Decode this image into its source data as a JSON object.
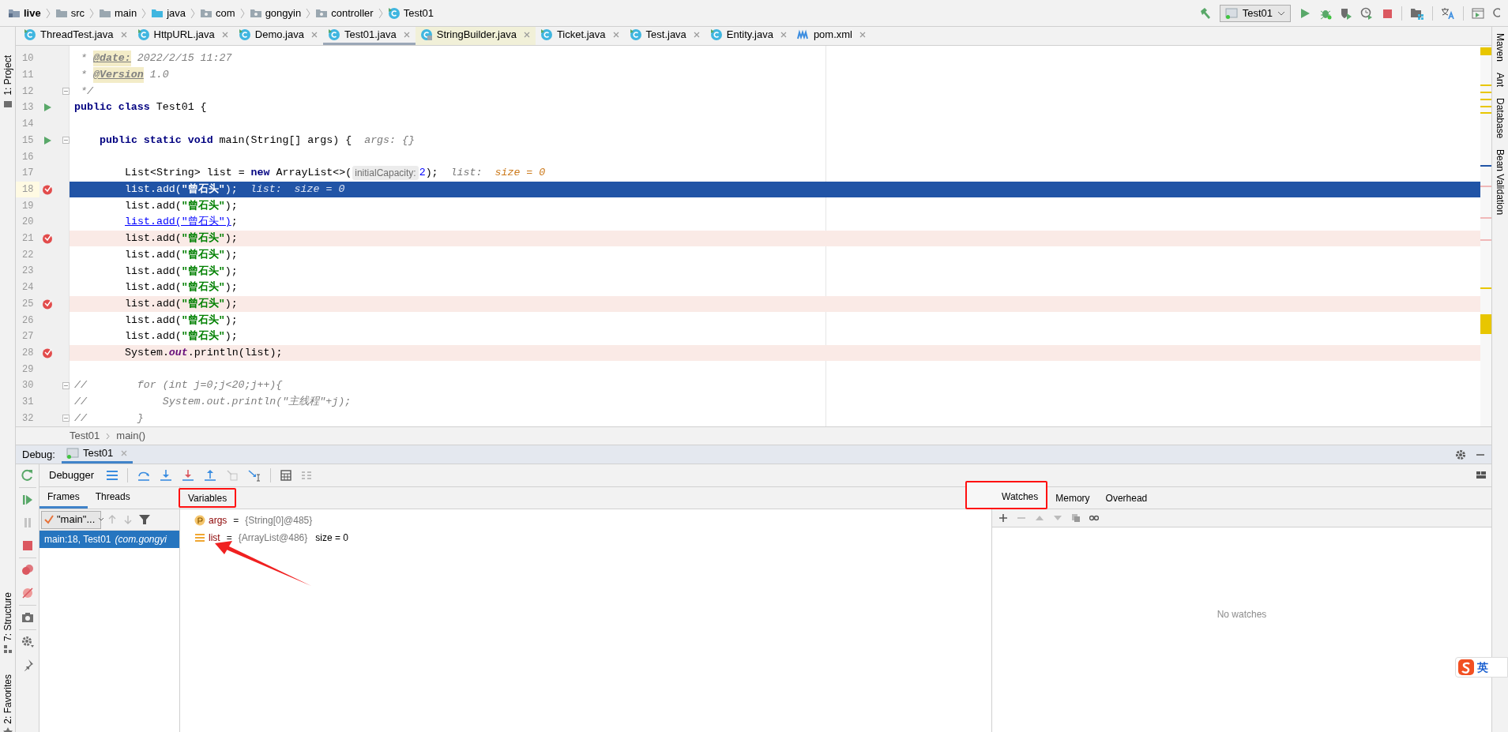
{
  "breadcrumbs": [
    {
      "label": "live",
      "kind": "module"
    },
    {
      "label": "src",
      "kind": "folder"
    },
    {
      "label": "main",
      "kind": "folder"
    },
    {
      "label": "java",
      "kind": "source-folder"
    },
    {
      "label": "com",
      "kind": "package"
    },
    {
      "label": "gongyin",
      "kind": "package"
    },
    {
      "label": "controller",
      "kind": "package"
    },
    {
      "label": "Test01",
      "kind": "class"
    }
  ],
  "run_config": {
    "label": "Test01"
  },
  "left_tool_windows": [
    {
      "label": "1: Project",
      "kind": "project"
    },
    {
      "label": "7: Structure",
      "kind": "structure"
    },
    {
      "label": "2: Favorites",
      "kind": "favorites"
    }
  ],
  "right_tool_windows": [
    {
      "label": "Maven"
    },
    {
      "label": "Ant"
    },
    {
      "label": "Database"
    },
    {
      "label": "Bean Validation"
    }
  ],
  "tabs": [
    {
      "label": "ThreadTest.java",
      "kind": "class",
      "selected": false
    },
    {
      "label": "HttpURL.java",
      "kind": "class",
      "selected": false
    },
    {
      "label": "Demo.java",
      "kind": "class",
      "selected": false
    },
    {
      "label": "Test01.java",
      "kind": "class",
      "selected": true
    },
    {
      "label": "StringBuilder.java",
      "kind": "library-class",
      "selected": false
    },
    {
      "label": "Ticket.java",
      "kind": "class",
      "selected": false
    },
    {
      "label": "Test.java",
      "kind": "class",
      "selected": false
    },
    {
      "label": "Entity.java",
      "kind": "class",
      "selected": false
    },
    {
      "label": "pom.xml",
      "kind": "maven",
      "selected": false
    }
  ],
  "editor": {
    "lines": [
      {
        "number": "10",
        "kind": "top",
        "tokens": [
          {
            "kind": "comment",
            "text": " * "
          },
          {
            "kind": "doctag",
            "text": "@date:"
          },
          {
            "kind": "comment",
            "text": " 2022/2/15 11:27"
          }
        ]
      },
      {
        "number": "11",
        "kind": "top",
        "tokens": [
          {
            "kind": "comment",
            "text": " * "
          },
          {
            "kind": "doctag",
            "text": "@Version"
          },
          {
            "kind": "comment",
            "text": " 1.0"
          }
        ]
      },
      {
        "number": "12",
        "kind": "top",
        "fold": true,
        "tokens": [
          {
            "kind": "comment",
            "text": " */"
          }
        ]
      },
      {
        "number": "13",
        "kind": "top",
        "run_marker": true,
        "tokens": [
          {
            "kind": "keyword",
            "text": "public class "
          },
          {
            "kind": "plain",
            "text": "Test01 {"
          }
        ]
      },
      {
        "number": "14",
        "kind": "top"
      },
      {
        "number": "15",
        "kind": "member",
        "run_marker": true,
        "fold": true,
        "tokens": [
          {
            "kind": "keyword",
            "text": "public static void "
          },
          {
            "kind": "plain",
            "text": "main(String[] args) {"
          },
          {
            "kind": "hint",
            "text": "  args: {}"
          }
        ]
      },
      {
        "number": "16",
        "kind": "top"
      },
      {
        "number": "17",
        "kind": "statement",
        "tokens": [
          {
            "kind": "plain",
            "text": "List<String> list = "
          },
          {
            "kind": "keyword",
            "text": "new"
          },
          {
            "kind": "plain",
            "text": " ArrayList<>("
          },
          {
            "kind": "inlay",
            "text": "initialCapacity:"
          },
          {
            "kind": "number",
            "text": "2"
          },
          {
            "kind": "plain",
            "text": ");"
          },
          {
            "kind": "hint",
            "text": "  list:  "
          },
          {
            "kind": "hint_value",
            "text": "size = 0"
          }
        ]
      },
      {
        "number": "18",
        "kind": "statement",
        "breakpoint": true,
        "current": true,
        "tokens": [
          {
            "kind": "plain",
            "text": "list.add("
          },
          {
            "kind": "string",
            "text": "\"曾石头\""
          },
          {
            "kind": "plain",
            "text": ");"
          },
          {
            "kind": "hint",
            "text": "  list:  size = 0"
          }
        ]
      },
      {
        "number": "19",
        "kind": "statement",
        "tokens": [
          {
            "kind": "plain",
            "text": "list.add("
          },
          {
            "kind": "string",
            "text": "\"曾石头\""
          },
          {
            "kind": "plain",
            "text": ");"
          }
        ]
      },
      {
        "number": "20",
        "kind": "statement",
        "tokens": [
          {
            "kind": "link",
            "text": "list.add(\"曾石头\")"
          },
          {
            "kind": "plain",
            "text": ";"
          }
        ]
      },
      {
        "number": "21",
        "kind": "statement",
        "breakpoint": true,
        "tokens": [
          {
            "kind": "plain",
            "text": "list.add("
          },
          {
            "kind": "string",
            "text": "\"曾石头\""
          },
          {
            "kind": "plain",
            "text": ");"
          }
        ]
      },
      {
        "number": "22",
        "kind": "statement",
        "tokens": [
          {
            "kind": "plain",
            "text": "list.add("
          },
          {
            "kind": "string",
            "text": "\"曾石头\""
          },
          {
            "kind": "plain",
            "text": ");"
          }
        ]
      },
      {
        "number": "23",
        "kind": "statement",
        "tokens": [
          {
            "kind": "plain",
            "text": "list.add("
          },
          {
            "kind": "string",
            "text": "\"曾石头\""
          },
          {
            "kind": "plain",
            "text": ");"
          }
        ]
      },
      {
        "number": "24",
        "kind": "statement",
        "tokens": [
          {
            "kind": "plain",
            "text": "list.add("
          },
          {
            "kind": "string",
            "text": "\"曾石头\""
          },
          {
            "kind": "plain",
            "text": ");"
          }
        ]
      },
      {
        "number": "25",
        "kind": "statement",
        "breakpoint": true,
        "tokens": [
          {
            "kind": "plain",
            "text": "list.add("
          },
          {
            "kind": "string",
            "text": "\"曾石头\""
          },
          {
            "kind": "plain",
            "text": ");"
          }
        ]
      },
      {
        "number": "26",
        "kind": "statement",
        "tokens": [
          {
            "kind": "plain",
            "text": "list.add("
          },
          {
            "kind": "string",
            "text": "\"曾石头\""
          },
          {
            "kind": "plain",
            "text": ");"
          }
        ]
      },
      {
        "number": "27",
        "kind": "statement",
        "tokens": [
          {
            "kind": "plain",
            "text": "list.add("
          },
          {
            "kind": "string",
            "text": "\"曾石头\""
          },
          {
            "kind": "plain",
            "text": ");"
          }
        ]
      },
      {
        "number": "28",
        "kind": "statement",
        "breakpoint": true,
        "tokens": [
          {
            "kind": "plain",
            "text": "System."
          },
          {
            "kind": "field",
            "text": "out"
          },
          {
            "kind": "plain",
            "text": ".println(list);"
          }
        ]
      },
      {
        "number": "29",
        "kind": "top"
      },
      {
        "number": "30",
        "kind": "top",
        "fold": true,
        "tokens": [
          {
            "kind": "comment",
            "text": "//        for (int j=0;j<20;j++){"
          }
        ]
      },
      {
        "number": "31",
        "kind": "top",
        "tokens": [
          {
            "kind": "comment",
            "text": "//            System.out.println(\"主线程\"+j);"
          }
        ]
      },
      {
        "number": "32",
        "kind": "top",
        "fold": true,
        "tokens": [
          {
            "kind": "comment",
            "text": "//        }"
          }
        ]
      }
    ],
    "breadcrumb": [
      "Test01",
      "main()"
    ]
  },
  "debug": {
    "label": "Debug:",
    "session": {
      "label": "Test01",
      "selected": true
    },
    "toolbar_label": "Debugger",
    "frame_tabs": [
      {
        "label": "Frames",
        "selected": true
      },
      {
        "label": "Threads",
        "selected": false
      }
    ],
    "thread": "\"main\"...",
    "frames": [
      {
        "location": "main:18, Test01",
        "package": "(com.gongyi",
        "selected": true
      }
    ],
    "variables_tab": {
      "label": "Variables",
      "outlined": true
    },
    "variables": [
      {
        "kind": "parameter",
        "name": "args",
        "operator": "=",
        "value": "{String[0]@485}",
        "pointed_at": false
      },
      {
        "kind": "list",
        "name": "list",
        "operator": "=",
        "value": "{ArrayList@486}",
        "extra": "size = 0",
        "pointed_at": true
      }
    ],
    "watch_tabs": [
      {
        "label": "Watches",
        "selected": true,
        "outlined": true
      },
      {
        "label": "Memory",
        "selected": false,
        "outlined": false
      },
      {
        "label": "Overhead",
        "selected": false,
        "outlined": false
      }
    ],
    "watches_empty": "No watches"
  },
  "ime_badge": {
    "label": "英"
  }
}
